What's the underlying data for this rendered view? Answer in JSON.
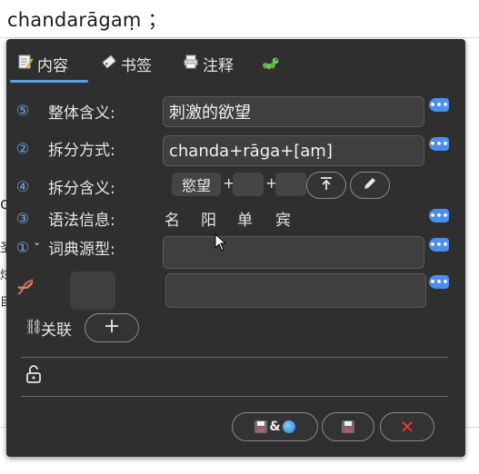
{
  "background": {
    "word": "chandarāgaṃ ；",
    "fragments": [
      "o",
      "圣",
      "炫",
      "目"
    ]
  },
  "tabs": [
    {
      "label": "内容",
      "icon": "memo-icon"
    },
    {
      "label": "书签",
      "icon": "bookmark-tag-icon"
    },
    {
      "label": "注释",
      "icon": "printer-icon"
    },
    {
      "label": "",
      "icon": "caterpillar-icon"
    }
  ],
  "rows": {
    "meaning": {
      "num": "⑤",
      "label": "整体含义:",
      "value": "刺激的欲望"
    },
    "split_method": {
      "num": "②",
      "label": "拆分方式:",
      "value": "chanda+rāga+[aṃ]"
    },
    "split_meaning": {
      "num": "④",
      "label": "拆分含义:",
      "parts": [
        "慾望",
        "",
        ""
      ],
      "sep": "+"
    },
    "grammar": {
      "num": "③",
      "label": "语法信息:",
      "items": [
        "名",
        "阳",
        "单",
        "宾"
      ]
    },
    "dict_source": {
      "num": "①",
      "label": "词典源型:",
      "value": ""
    },
    "dna": {
      "value": ""
    }
  },
  "relation": {
    "label": "关联"
  },
  "more_label": "•••",
  "actions": {
    "save_web_amp": "&"
  },
  "colors": {
    "panel": "#2f2f2f",
    "accent": "#5aa0e6",
    "badge": "#4a8ff0",
    "cancel": "#e23b3b"
  }
}
